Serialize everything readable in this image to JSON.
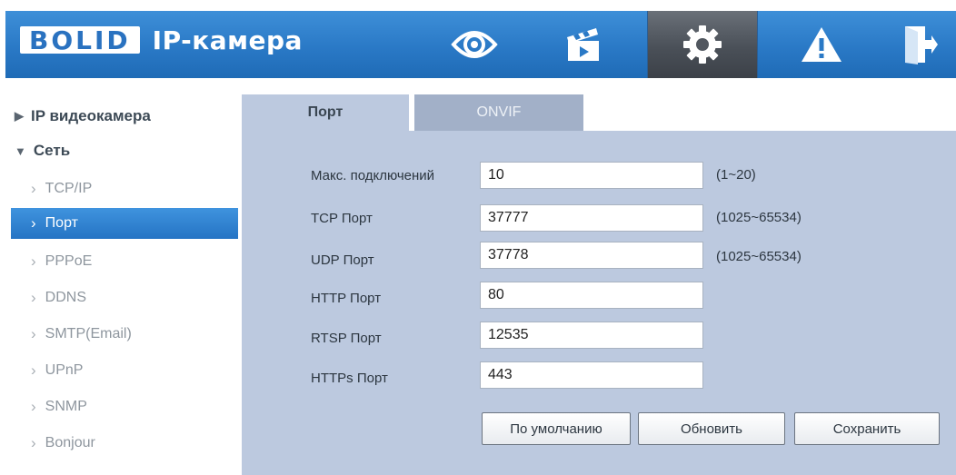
{
  "header": {
    "logo_brand": "BOLID",
    "logo_text": "IP-камера",
    "nav": [
      {
        "icon": "eye-icon",
        "active": false
      },
      {
        "icon": "clapperboard-icon",
        "active": false
      },
      {
        "icon": "gear-icon",
        "active": true
      },
      {
        "icon": "warning-icon",
        "active": false
      },
      {
        "icon": "logout-icon",
        "active": false
      }
    ]
  },
  "sidebar": {
    "categories": [
      {
        "label": "IP видеокамера",
        "expanded": false
      },
      {
        "label": "Сеть",
        "expanded": true
      }
    ],
    "items": [
      {
        "label": "TCP/IP"
      },
      {
        "label": "Порт",
        "active": true
      },
      {
        "label": "PPPoE"
      },
      {
        "label": "DDNS"
      },
      {
        "label": "SMTP(Email)"
      },
      {
        "label": "UPnP"
      },
      {
        "label": "SNMP"
      },
      {
        "label": "Bonjour"
      }
    ]
  },
  "tabs": [
    {
      "label": "Порт",
      "active": true
    },
    {
      "label": "ONVIF",
      "active": false
    }
  ],
  "form": {
    "fields": [
      {
        "label": "Макс. подключений",
        "value": "10",
        "hint": "(1~20)"
      },
      {
        "label": "TCP Порт",
        "value": "37777",
        "hint": "(1025~65534)"
      },
      {
        "label": "UDP Порт",
        "value": "37778",
        "hint": "(1025~65534)"
      },
      {
        "label": "HTTP Порт",
        "value": "80",
        "hint": ""
      },
      {
        "label": "RTSP Порт",
        "value": "12535",
        "hint": ""
      },
      {
        "label": "HTTPs Порт",
        "value": "443",
        "hint": ""
      }
    ],
    "buttons": {
      "default": "По умолчанию",
      "refresh": "Обновить",
      "save": "Сохранить"
    }
  },
  "colors": {
    "header": "#2a79c6",
    "accent": "#3a86d2",
    "panel": "#bcc9df"
  }
}
